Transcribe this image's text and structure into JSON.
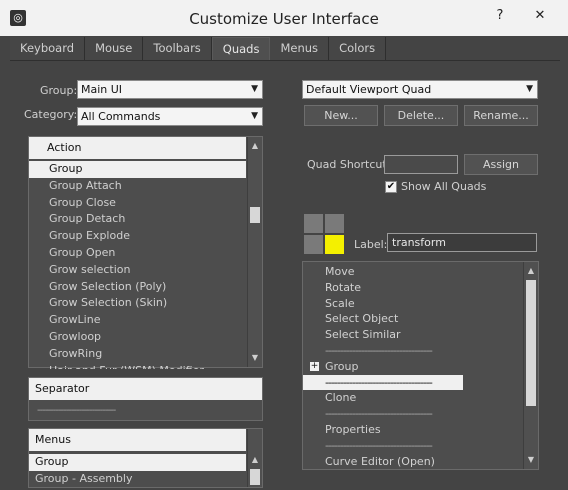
{
  "window": {
    "title": "Customize User Interface",
    "help_label": "?",
    "close_label": "✕"
  },
  "tabs": [
    {
      "label": "Keyboard"
    },
    {
      "label": "Mouse"
    },
    {
      "label": "Toolbars"
    },
    {
      "label": "Quads"
    },
    {
      "label": "Menus"
    },
    {
      "label": "Colors"
    }
  ],
  "active_tab": "Quads",
  "left": {
    "group_label": "Group:",
    "group_value": "Main UI",
    "category_label": "Category:",
    "category_value": "All Commands",
    "actions_header": "Action",
    "actions": [
      "Group",
      "Group Attach",
      "Group Close",
      "Group Detach",
      "Group Explode",
      "Group Open",
      "Grow selection",
      "Grow Selection (Poly)",
      "Grow Selection (Skin)",
      "GrowLine",
      "Growloop",
      "GrowRing",
      "Hair and Fur (WSM) Modifier"
    ],
    "actions_selected_index": 0,
    "separator_header": "Separator",
    "separator_line": "------------------------------",
    "menus_header": "Menus",
    "menus": [
      "Group",
      "Group - Assembly"
    ],
    "menus_selected_index": 0
  },
  "right": {
    "quad_set_value": "Default Viewport Quad",
    "new_label": "New...",
    "delete_label": "Delete...",
    "rename_label": "Rename...",
    "quad_shortcut_label": "Quad Shortcut:",
    "quad_shortcut_value": "",
    "assign_label": "Assign",
    "show_all_quads_label": "Show All Quads",
    "show_all_quads_checked": true,
    "check_glyph": "✔",
    "label_label": "Label:",
    "label_value": "transform",
    "highlight_color": "#f4f000",
    "quad_items": [
      {
        "text": "Move",
        "type": "item"
      },
      {
        "text": "Rotate",
        "type": "item"
      },
      {
        "text": "Scale",
        "type": "item"
      },
      {
        "text": "Select Object",
        "type": "item"
      },
      {
        "text": "Select Similar",
        "type": "item"
      },
      {
        "text": "------------------------------------",
        "type": "separator"
      },
      {
        "text": "Group",
        "type": "submenu",
        "expander": "+"
      },
      {
        "text": "------------------------------------",
        "type": "separator",
        "selected": true
      },
      {
        "text": "Clone",
        "type": "item"
      },
      {
        "text": "------------------------------------",
        "type": "separator"
      },
      {
        "text": "Properties",
        "type": "item"
      },
      {
        "text": "------------------------------------",
        "type": "separator"
      },
      {
        "text": "Curve Editor (Open)",
        "type": "item"
      }
    ]
  },
  "scroll_arrows": {
    "up": "▲",
    "down": "▼"
  },
  "dropdown_arrow": "▼",
  "icons": {
    "app": "3ds-max-logo-icon"
  }
}
